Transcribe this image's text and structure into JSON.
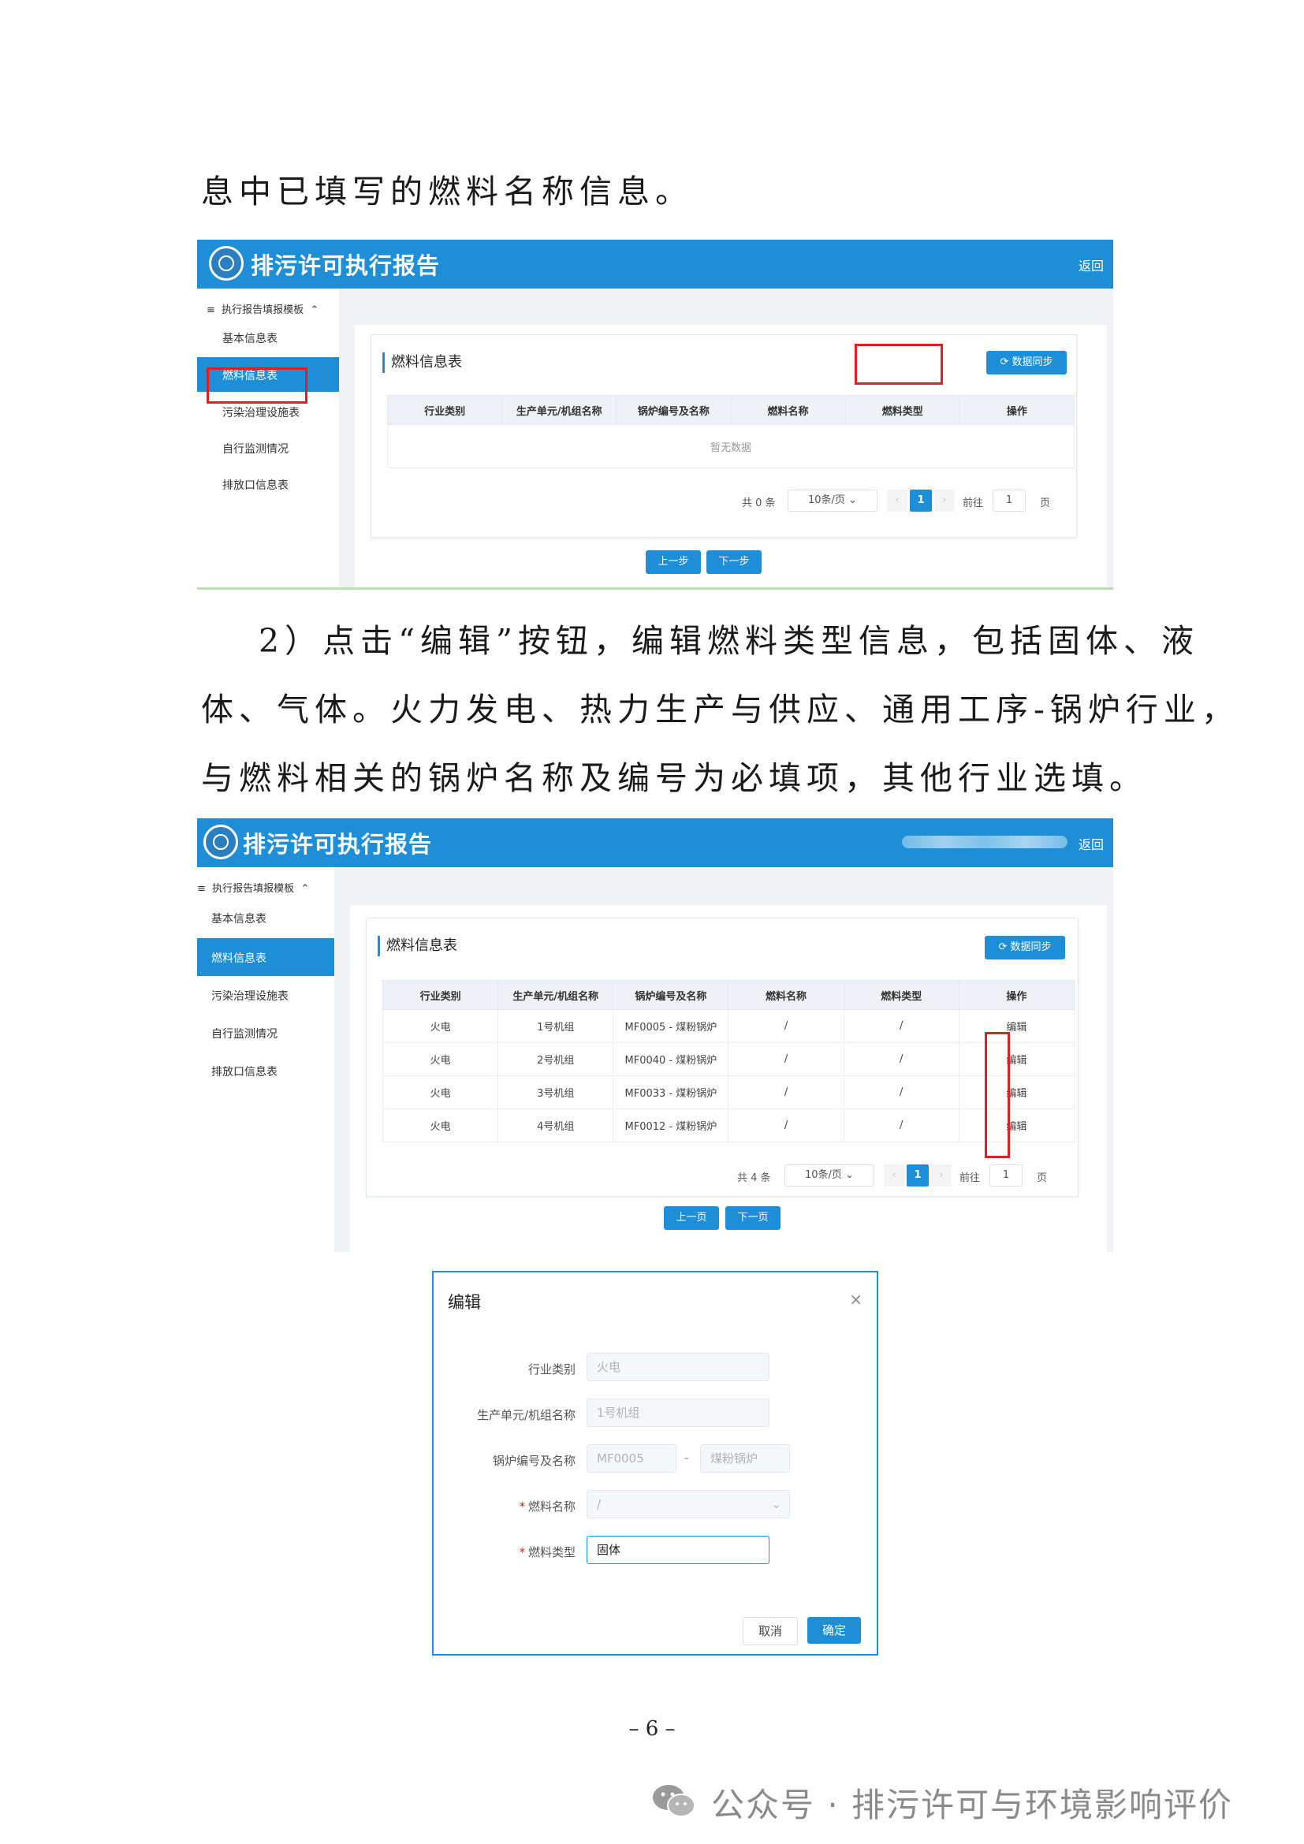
{
  "text": {
    "line0": "息中已填写的燃料名称信息。",
    "line1": "2）点击“编辑”按钮，编辑燃料类型信息，包括固体、液",
    "line2": "体、气体。火力发电、热力生产与供应、通用工序-锅炉行业，",
    "line3": "与燃料相关的锅炉名称及编号为必填项，其他行业选填。"
  },
  "app": {
    "title": "排污许可执行报告",
    "back": "返回",
    "menu_group": "执行报告填报模板",
    "menu_items": [
      "基本信息表",
      "燃料信息表",
      "污染治理设施表",
      "自行监测情况",
      "排放口信息表"
    ],
    "card_title": "燃料信息表",
    "sync_btn": "数据同步",
    "columns": [
      "行业类别",
      "生产单元/机组名称",
      "锅炉编号及名称",
      "燃料名称",
      "燃料类型",
      "操作"
    ],
    "empty": "暂无数据",
    "page_size": "10条/页",
    "goto": "前往",
    "page_unit": "页",
    "current_page": "1"
  },
  "shot1": {
    "total": "共 0 条",
    "prev": "上一步",
    "next": "下一步"
  },
  "shot2": {
    "total": "共 4 条",
    "prev": "上一页",
    "next": "下一页",
    "rows": [
      [
        "火电",
        "1号机组",
        "MF0005 - 煤粉锅炉",
        "/",
        "/",
        "编辑"
      ],
      [
        "火电",
        "2号机组",
        "MF0040 - 煤粉锅炉",
        "/",
        "/",
        "编辑"
      ],
      [
        "火电",
        "3号机组",
        "MF0033 - 煤粉锅炉",
        "/",
        "/",
        "编辑"
      ],
      [
        "火电",
        "4号机组",
        "MF0012 - 煤粉锅炉",
        "/",
        "/",
        "编辑"
      ]
    ]
  },
  "dialog": {
    "title": "编辑",
    "labels": [
      "行业类别",
      "生产单元/机组名称",
      "锅炉编号及名称",
      "燃料名称",
      "燃料类型"
    ],
    "industry": "火电",
    "unit": "1号机组",
    "boiler_no": "MF0005",
    "dash": "-",
    "boiler_name": "煤粉锅炉",
    "fuel_name": "/",
    "fuel_type": "固体",
    "cancel": "取消",
    "ok": "确定"
  },
  "page_number": "– 6 –",
  "watermark": "公众号 · 排污许可与环境影响评价"
}
